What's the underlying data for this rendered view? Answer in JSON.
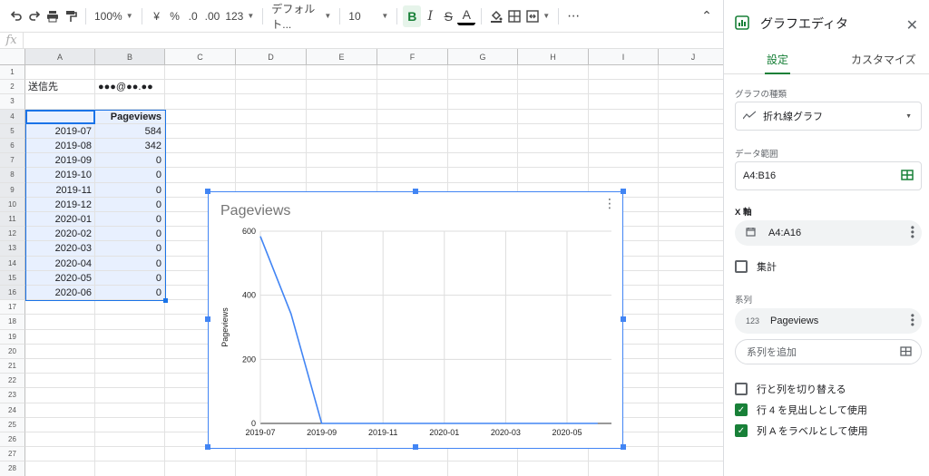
{
  "toolbar": {
    "zoom": "100%",
    "currency": "¥",
    "percent": "%",
    "decimal_less": ".0",
    "decimal_more": ".00",
    "format_123": "123",
    "font": "デフォルト...",
    "font_size": "10",
    "bold": "B",
    "italic": "I",
    "strike": "S",
    "text_color": "A",
    "more": "⋯",
    "collapse": "⌃"
  },
  "formula_bar": {
    "fx": "fx",
    "value": ""
  },
  "grid": {
    "columns": [
      "A",
      "B",
      "C",
      "D",
      "E",
      "F",
      "G",
      "H",
      "I",
      "J"
    ],
    "rows": [
      "1",
      "2",
      "3",
      "4",
      "5",
      "6",
      "7",
      "8",
      "9",
      "10",
      "11",
      "12",
      "13",
      "14",
      "15",
      "16",
      "17",
      "18",
      "19",
      "20",
      "21",
      "22",
      "23",
      "24",
      "25",
      "26",
      "27",
      "28"
    ],
    "cells": {
      "A2": "送信先",
      "B2": "●●●@●●.●●",
      "B4": "Pageviews",
      "data": [
        [
          "2019-07",
          "584"
        ],
        [
          "2019-08",
          "342"
        ],
        [
          "2019-09",
          "0"
        ],
        [
          "2019-10",
          "0"
        ],
        [
          "2019-11",
          "0"
        ],
        [
          "2019-12",
          "0"
        ],
        [
          "2020-01",
          "0"
        ],
        [
          "2020-02",
          "0"
        ],
        [
          "2020-03",
          "0"
        ],
        [
          "2020-04",
          "0"
        ],
        [
          "2020-05",
          "0"
        ],
        [
          "2020-06",
          "0"
        ]
      ]
    }
  },
  "chart_data": {
    "type": "line",
    "title": "Pageviews",
    "xlabel": "",
    "ylabel": "Pageviews",
    "categories": [
      "2019-07",
      "2019-08",
      "2019-09",
      "2019-10",
      "2019-11",
      "2019-12",
      "2020-01",
      "2020-02",
      "2020-03",
      "2020-04",
      "2020-05",
      "2020-06"
    ],
    "series": [
      {
        "name": "Pageviews",
        "values": [
          584,
          342,
          0,
          0,
          0,
          0,
          0,
          0,
          0,
          0,
          0,
          0
        ],
        "color": "#4285f4"
      }
    ],
    "xticks": [
      "2019-07",
      "2019-09",
      "2019-11",
      "2020-01",
      "2020-03",
      "2020-05"
    ],
    "yticks": [
      0,
      200,
      400,
      600
    ],
    "ylim": [
      0,
      600
    ],
    "grid": true
  },
  "panel": {
    "title": "グラフエディタ",
    "close": "✕",
    "tabs": [
      "設定",
      "カスタマイズ"
    ],
    "chart_type_label": "グラフの種類",
    "chart_type_value": "折れ線グラフ",
    "data_range_label": "データ範囲",
    "data_range_value": "A4:B16",
    "x_axis_label": "X 軸",
    "x_axis_value": "A4:A16",
    "aggregate_label": "集計",
    "series_label": "系列",
    "series_icon": "123",
    "series_value": "Pageviews",
    "add_series_placeholder": "系列を追加",
    "options": [
      {
        "label": "行と列を切り替える",
        "checked": false
      },
      {
        "label": "行 4 を見出しとして使用",
        "checked": true
      },
      {
        "label": "列 A をラベルとして使用",
        "checked": true
      }
    ]
  },
  "colors": {
    "accent": "#188038",
    "chart_line": "#4285f4",
    "selection": "#e8f0fe"
  }
}
